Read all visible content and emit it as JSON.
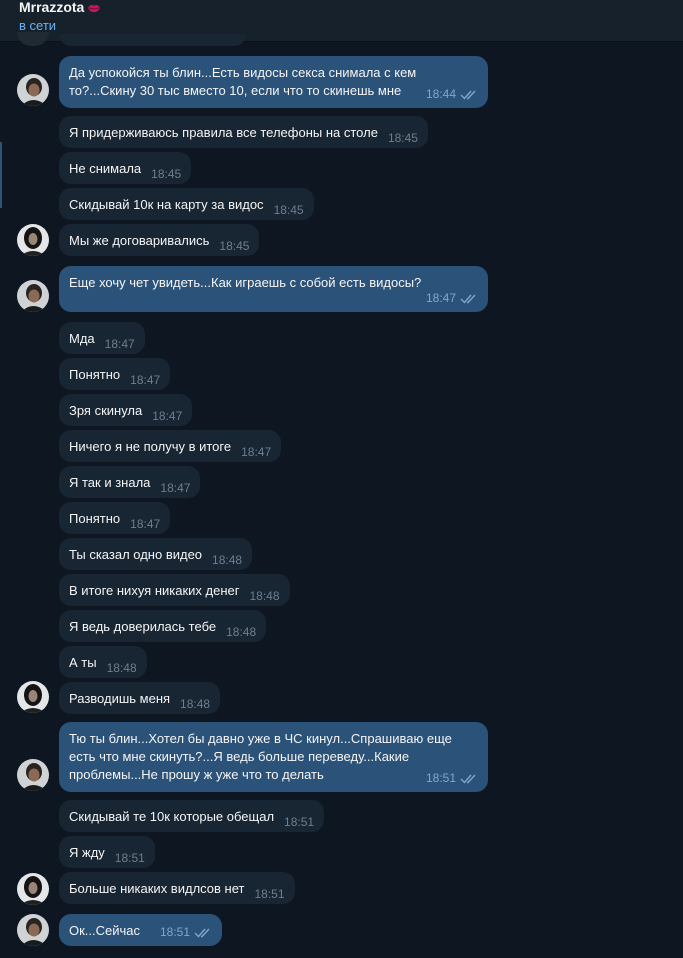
{
  "header": {
    "title": "Mrrazzota",
    "title_emoji": "lips-icon",
    "status": "в сети"
  },
  "colors": {
    "background": "#0e1621",
    "header": "#17212b",
    "incoming_bubble": "#182533",
    "outgoing_bubble": "#2b5278",
    "status_accent": "#6ab3f3"
  },
  "messages": [
    {
      "dir": "out",
      "text": "Да успокойся ты блин...Есть видосы секса снимала с кем то?...Скину 30 тыс вместо 10, если что то скинешь мне",
      "time": "18:44",
      "read": true
    },
    {
      "dir": "in",
      "text": "Я придерживаюсь правила все телефоны на столе",
      "time": "18:45"
    },
    {
      "dir": "in",
      "text": "Не снимала",
      "time": "18:45"
    },
    {
      "dir": "in",
      "text": "Скидывай 10к на карту за видос",
      "time": "18:45"
    },
    {
      "dir": "in",
      "text": "Мы же договаривались",
      "time": "18:45"
    },
    {
      "dir": "out",
      "text": "Еще хочу чет увидеть...Как играешь с собой есть видосы?",
      "time": "18:47",
      "read": true
    },
    {
      "dir": "in",
      "text": "Мда",
      "time": "18:47"
    },
    {
      "dir": "in",
      "text": "Понятно",
      "time": "18:47"
    },
    {
      "dir": "in",
      "text": "Зря скинула",
      "time": "18:47"
    },
    {
      "dir": "in",
      "text": "Ничего я не получу в итоге",
      "time": "18:47"
    },
    {
      "dir": "in",
      "text": "Я так и знала",
      "time": "18:47"
    },
    {
      "dir": "in",
      "text": "Понятно",
      "time": "18:47"
    },
    {
      "dir": "in",
      "text": "Ты сказал одно видео",
      "time": "18:48"
    },
    {
      "dir": "in",
      "text": "В итоге нихуя никаких денег",
      "time": "18:48"
    },
    {
      "dir": "in",
      "text": "Я ведь доверилась тебе",
      "time": "18:48"
    },
    {
      "dir": "in",
      "text": "А ты",
      "time": "18:48"
    },
    {
      "dir": "in",
      "text": "Разводишь меня",
      "time": "18:48"
    },
    {
      "dir": "out",
      "text": "Тю ты блин...Хотел бы давно уже в ЧС кинул...Спрашиваю еще есть что мне скинуть?...Я ведь больше переведу...Какие проблемы...Не прошу ж уже что то делать",
      "time": "18:51",
      "read": true
    },
    {
      "dir": "in",
      "text": "Скидывай те 10к которые обещал",
      "time": "18:51"
    },
    {
      "dir": "in",
      "text": "Я жду",
      "time": "18:51"
    },
    {
      "dir": "in",
      "text": "Больше никаких видлсов нет",
      "time": "18:51"
    },
    {
      "dir": "out",
      "text": "Ок...Сейчас",
      "time": "18:51",
      "read": true
    }
  ]
}
